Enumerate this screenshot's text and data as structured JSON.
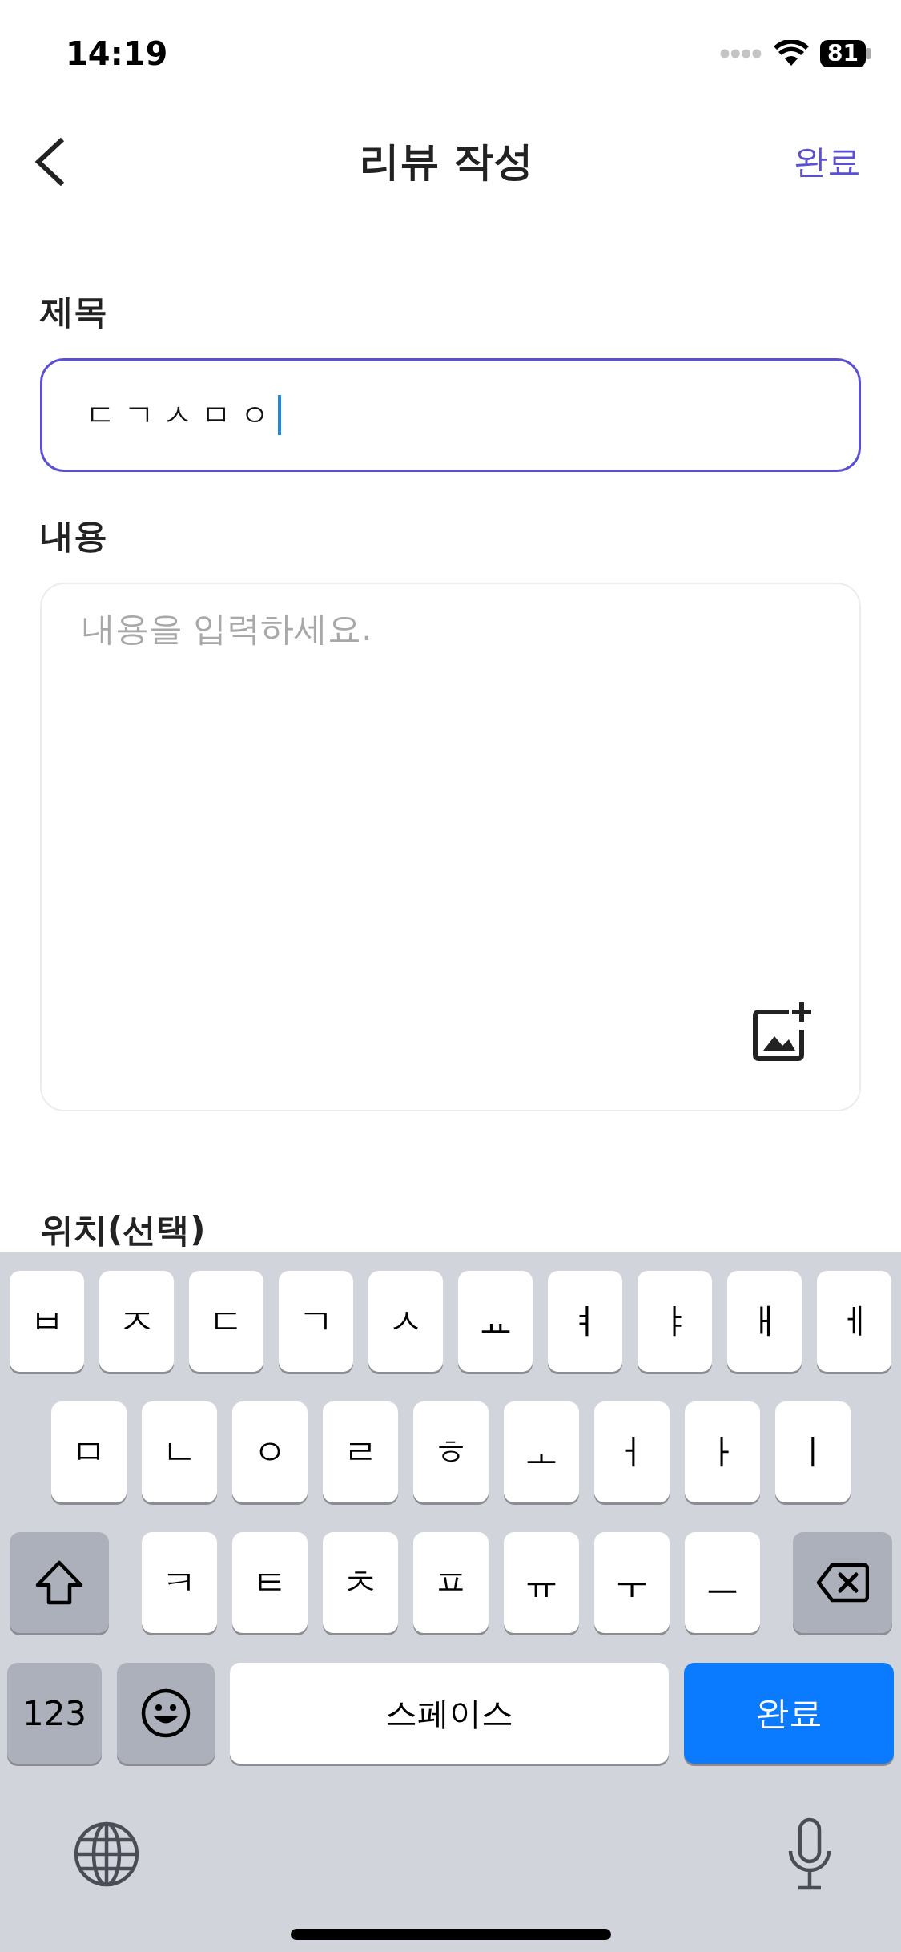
{
  "status_bar": {
    "time": "14:19",
    "battery": "81"
  },
  "header": {
    "title": "리뷰 작성",
    "action": "완료"
  },
  "form": {
    "title_label": "제목",
    "title_value": "ㄷㄱㅅㅁㅇ",
    "content_label": "내용",
    "content_placeholder": "내용을 입력하세요.",
    "location_label": "위치(선택)"
  },
  "keyboard": {
    "rows": [
      {
        "keys": [
          {
            "kind": "letter",
            "label": "ㅂ"
          },
          {
            "kind": "letter",
            "label": "ㅈ"
          },
          {
            "kind": "letter",
            "label": "ㄷ"
          },
          {
            "kind": "letter",
            "label": "ㄱ"
          },
          {
            "kind": "letter",
            "label": "ㅅ"
          },
          {
            "kind": "letter",
            "label": "ㅛ"
          },
          {
            "kind": "letter",
            "label": "ㅕ"
          },
          {
            "kind": "letter",
            "label": "ㅑ"
          },
          {
            "kind": "letter",
            "label": "ㅐ"
          },
          {
            "kind": "letter",
            "label": "ㅔ"
          }
        ]
      },
      {
        "keys": [
          {
            "kind": "letter",
            "label": "ㅁ"
          },
          {
            "kind": "letter",
            "label": "ㄴ"
          },
          {
            "kind": "letter",
            "label": "ㅇ"
          },
          {
            "kind": "letter",
            "label": "ㄹ"
          },
          {
            "kind": "letter",
            "label": "ㅎ"
          },
          {
            "kind": "letter",
            "label": "ㅗ"
          },
          {
            "kind": "letter",
            "label": "ㅓ"
          },
          {
            "kind": "letter",
            "label": "ㅏ"
          },
          {
            "kind": "letter",
            "label": "ㅣ"
          }
        ]
      },
      {
        "keys": [
          {
            "kind": "shift"
          },
          {
            "kind": "letter",
            "label": "ㅋ"
          },
          {
            "kind": "letter",
            "label": "ㅌ"
          },
          {
            "kind": "letter",
            "label": "ㅊ"
          },
          {
            "kind": "letter",
            "label": "ㅍ"
          },
          {
            "kind": "letter",
            "label": "ㅠ"
          },
          {
            "kind": "letter",
            "label": "ㅜ"
          },
          {
            "kind": "letter",
            "label": "ㅡ"
          },
          {
            "kind": "backspace"
          }
        ]
      },
      {
        "keys": [
          {
            "kind": "numbers",
            "label": "123"
          },
          {
            "kind": "emoji"
          },
          {
            "kind": "space",
            "label": "스페이스"
          },
          {
            "kind": "return",
            "label": "완료"
          }
        ]
      }
    ]
  }
}
